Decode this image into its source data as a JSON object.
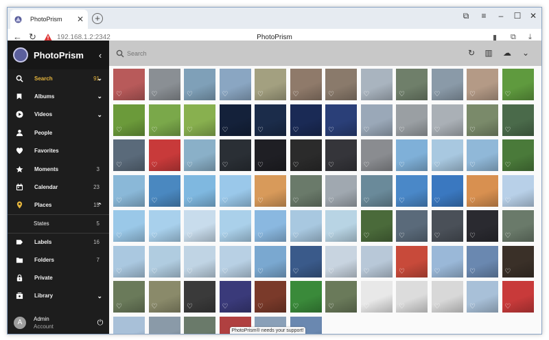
{
  "browser": {
    "tab_title": "PhotoPrism",
    "url": "192.168.1.2:2342",
    "page_title": "PhotoPrism"
  },
  "sidebar": {
    "brand": "PhotoPrism",
    "items": [
      {
        "label": "Search",
        "count": "91",
        "icon": "search-icon",
        "chevron": "down",
        "active": true
      },
      {
        "label": "Albums",
        "count": "",
        "icon": "bookmark-icon",
        "chevron": "down"
      },
      {
        "label": "Videos",
        "count": "",
        "icon": "play-circle-icon",
        "chevron": "down"
      },
      {
        "label": "People",
        "count": "",
        "icon": "person-icon"
      },
      {
        "label": "Favorites",
        "count": "",
        "icon": "heart-icon"
      },
      {
        "label": "Moments",
        "count": "3",
        "icon": "star-icon"
      },
      {
        "label": "Calendar",
        "count": "23",
        "icon": "calendar-icon"
      },
      {
        "label": "Places",
        "count": "15",
        "icon": "place-pin-icon",
        "chevron": "up"
      },
      {
        "label": "States",
        "count": "5",
        "sub": true
      },
      {
        "label": "Labels",
        "count": "16",
        "icon": "label-icon"
      },
      {
        "label": "Folders",
        "count": "7",
        "icon": "folder-icon"
      },
      {
        "label": "Private",
        "count": "",
        "icon": "lock-icon"
      },
      {
        "label": "Library",
        "count": "",
        "icon": "library-icon",
        "chevron": "down"
      }
    ],
    "user": {
      "initial": "A",
      "name": "Admin",
      "role": "Account"
    }
  },
  "toolbar": {
    "search_placeholder": "Search"
  },
  "photos": [
    [
      "#b85a5a",
      "#8a8f94",
      "#7fa0b8",
      "#8aa6c2",
      "#a3a080",
      "#8f7a6a",
      "#8a7a6b",
      "#a9b4bf",
      "#6f7f6a",
      "#8a9aa8",
      "#b49a86",
      "#5f9a3e"
    ],
    [
      "#6b9a3a",
      "#7aa84a",
      "#88b04f",
      "#14213a",
      "#1b2c4a",
      "#1a2a55",
      "#2a3f78",
      "#9aa8b8",
      "#9a9fa3",
      "#aab0b6",
      "#7a8a6a",
      "#4a6a4a"
    ],
    [
      "#5a6a7a",
      "#c83a3a",
      "#8ab0c8",
      "#2a2f35",
      "#1f1f24",
      "#2b2b2b",
      "#35353a",
      "#8a8c90",
      "#7fb0d8",
      "#a8c8e0",
      "#90b8d8",
      "#4a7a3a"
    ],
    [
      "#8ab8d8",
      "#4a88c0",
      "#7fb8e0",
      "#9ac8ea",
      "#d89a5a",
      "#6a7a6a",
      "#a0a8b0",
      "#6a8a9a",
      "#4a88c8",
      "#3a78c0",
      "#d89050",
      "#b8d0e8"
    ],
    [
      "#9ac8e8",
      "#a8d0ec",
      "#c8dcec",
      "#aad0ea",
      "#8ab8e0",
      "#a8c8e0",
      "#b8d4e4",
      "#4a6a3a",
      "#5a6a7a",
      "#4a5058",
      "#2a2a30",
      "#6a7a6a"
    ],
    [
      "#aac8e0",
      "#b0cce0",
      "#c0d4e4",
      "#b8d0e4",
      "#7aa8d0",
      "#3a5a8a",
      "#c8d4e0",
      "#b8c8d8",
      "#c84a3a",
      "#9ab8d8",
      "#6a88b0",
      "#3a3028"
    ],
    [
      "#6a7a5a",
      "#8a8a6a",
      "#3a3a3a",
      "#3a3a7a",
      "#7a3a2a",
      "#3a8a3a",
      "#6a7a5a",
      "#e8e8e8",
      "#dcdcdc",
      "#d8d8d8",
      "#a8c0d8",
      "#c83a3a"
    ],
    [
      "#a8c0d8",
      "#8a9aa8",
      "#6a7a6a",
      "#b04040",
      "#8aa0b8",
      "#6a88b0"
    ]
  ]
}
